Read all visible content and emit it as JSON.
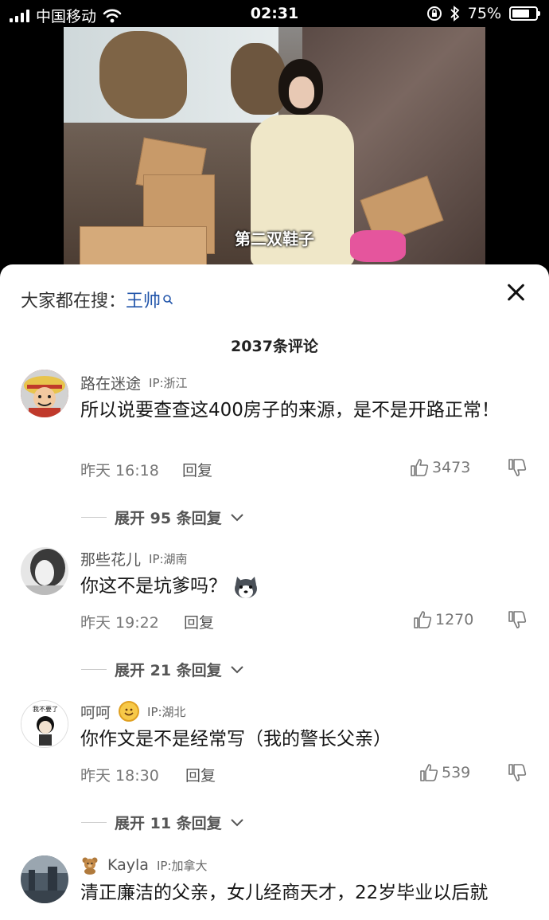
{
  "status_bar": {
    "carrier": "中国移动",
    "time": "02:31",
    "battery": "75%",
    "battery_level": 0.75
  },
  "video": {
    "subtitle": "第二双鞋子"
  },
  "search": {
    "prefix": "大家都在搜：",
    "term": "王帅"
  },
  "comments_header": {
    "count_label": "2037条评论"
  },
  "comments": [
    {
      "user": "路在迷途",
      "ip": "IP:浙江",
      "text": "所以说要查查这400房子的来源，是不是开路正常！",
      "time": "昨天 16:18",
      "reply": "回复",
      "likes": "3473",
      "expand": "展开 95 条回复"
    },
    {
      "user": "那些花儿",
      "ip": "IP:湖南",
      "text": "你这不是坑爹吗？",
      "time": "昨天 19:22",
      "reply": "回复",
      "likes": "1270",
      "expand": "展开 21 条回复"
    },
    {
      "user": "呵呵",
      "ip": "IP:湖北",
      "text": "你作文是不是经常写（我的警长父亲）",
      "time": "昨天 18:30",
      "reply": "回复",
      "likes": "539",
      "expand": "展开 11 条回复"
    },
    {
      "user": "Kayla",
      "ip": "IP:加拿大",
      "text": "清正廉洁的父亲，女儿经商天才，22岁毕业以后就"
    }
  ],
  "avatar_badge_text": "我不要了"
}
